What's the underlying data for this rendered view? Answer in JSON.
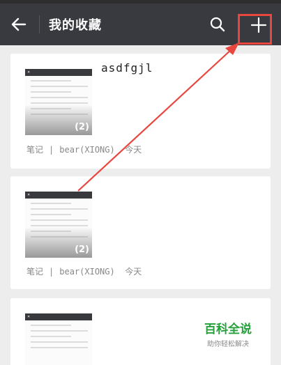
{
  "header": {
    "title": "我的收藏"
  },
  "cards": [
    {
      "title": "asdfgjl",
      "type": "笔记",
      "separator": "|",
      "author": "bear(XIONG)",
      "date": "今天",
      "thumb_count": "(2)"
    },
    {
      "title": "",
      "type": "笔记",
      "separator": "|",
      "author": "bear(XIONG)",
      "date": "今天",
      "thumb_count": "(2)"
    },
    {
      "title": "",
      "thumb_count": ""
    }
  ],
  "watermark": {
    "main": "百科全说",
    "sub": "助你轻松解决"
  },
  "colors": {
    "topbar": "#393a3f",
    "highlight": "#e8463f",
    "watermark": "#25a03a"
  },
  "icons": [
    "back-arrow-icon",
    "search-icon",
    "plus-icon"
  ]
}
